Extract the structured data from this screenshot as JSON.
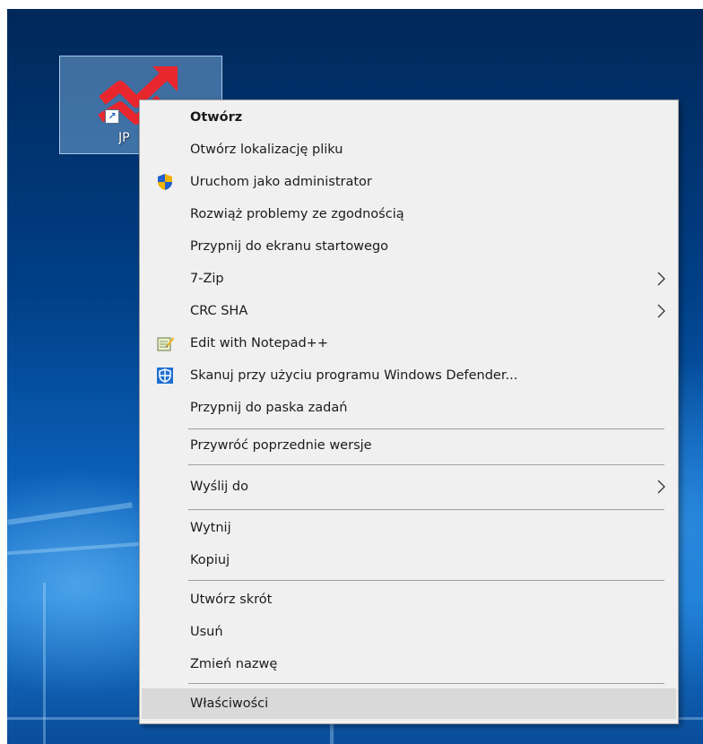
{
  "desktop": {
    "shortcut": {
      "label": "JP",
      "icon": "app-chart-arrow-icon",
      "overlay_icon": "shortcut-arrow-icon",
      "overlay_glyph": "↗"
    }
  },
  "context_menu": {
    "items": [
      {
        "label": "Otwórz",
        "bold": true
      },
      {
        "label": "Otwórz lokalizację pliku"
      },
      {
        "label": "Uruchom jako administrator",
        "icon": "uac-shield-icon"
      },
      {
        "label": "Rozwiąż problemy ze zgodnością"
      },
      {
        "label": "Przypnij do ekranu startowego"
      },
      {
        "label": "7-Zip",
        "submenu": true
      },
      {
        "label": "CRC SHA",
        "submenu": true
      },
      {
        "label": "Edit with Notepad++",
        "icon": "notepad-plus-plus-icon"
      },
      {
        "label": "Skanuj przy użyciu programu Windows Defender...",
        "icon": "windows-defender-icon"
      },
      {
        "label": "Przypnij do paska zadań"
      },
      {
        "label": "Przywróć poprzednie wersje"
      },
      {
        "label": "Wyślij do",
        "submenu": true
      },
      {
        "label": "Wytnij"
      },
      {
        "label": "Kopiuj"
      },
      {
        "label": "Utwórz skrót"
      },
      {
        "label": "Usuń"
      },
      {
        "label": "Zmień nazwę"
      },
      {
        "label": "Właściwości",
        "highlighted": true
      }
    ]
  },
  "colors": {
    "menu_background": "#f0f0f0",
    "menu_highlight": "#d9d9d9",
    "menu_border": "#a0a0a0",
    "desktop_blue": "#0a5db5"
  }
}
